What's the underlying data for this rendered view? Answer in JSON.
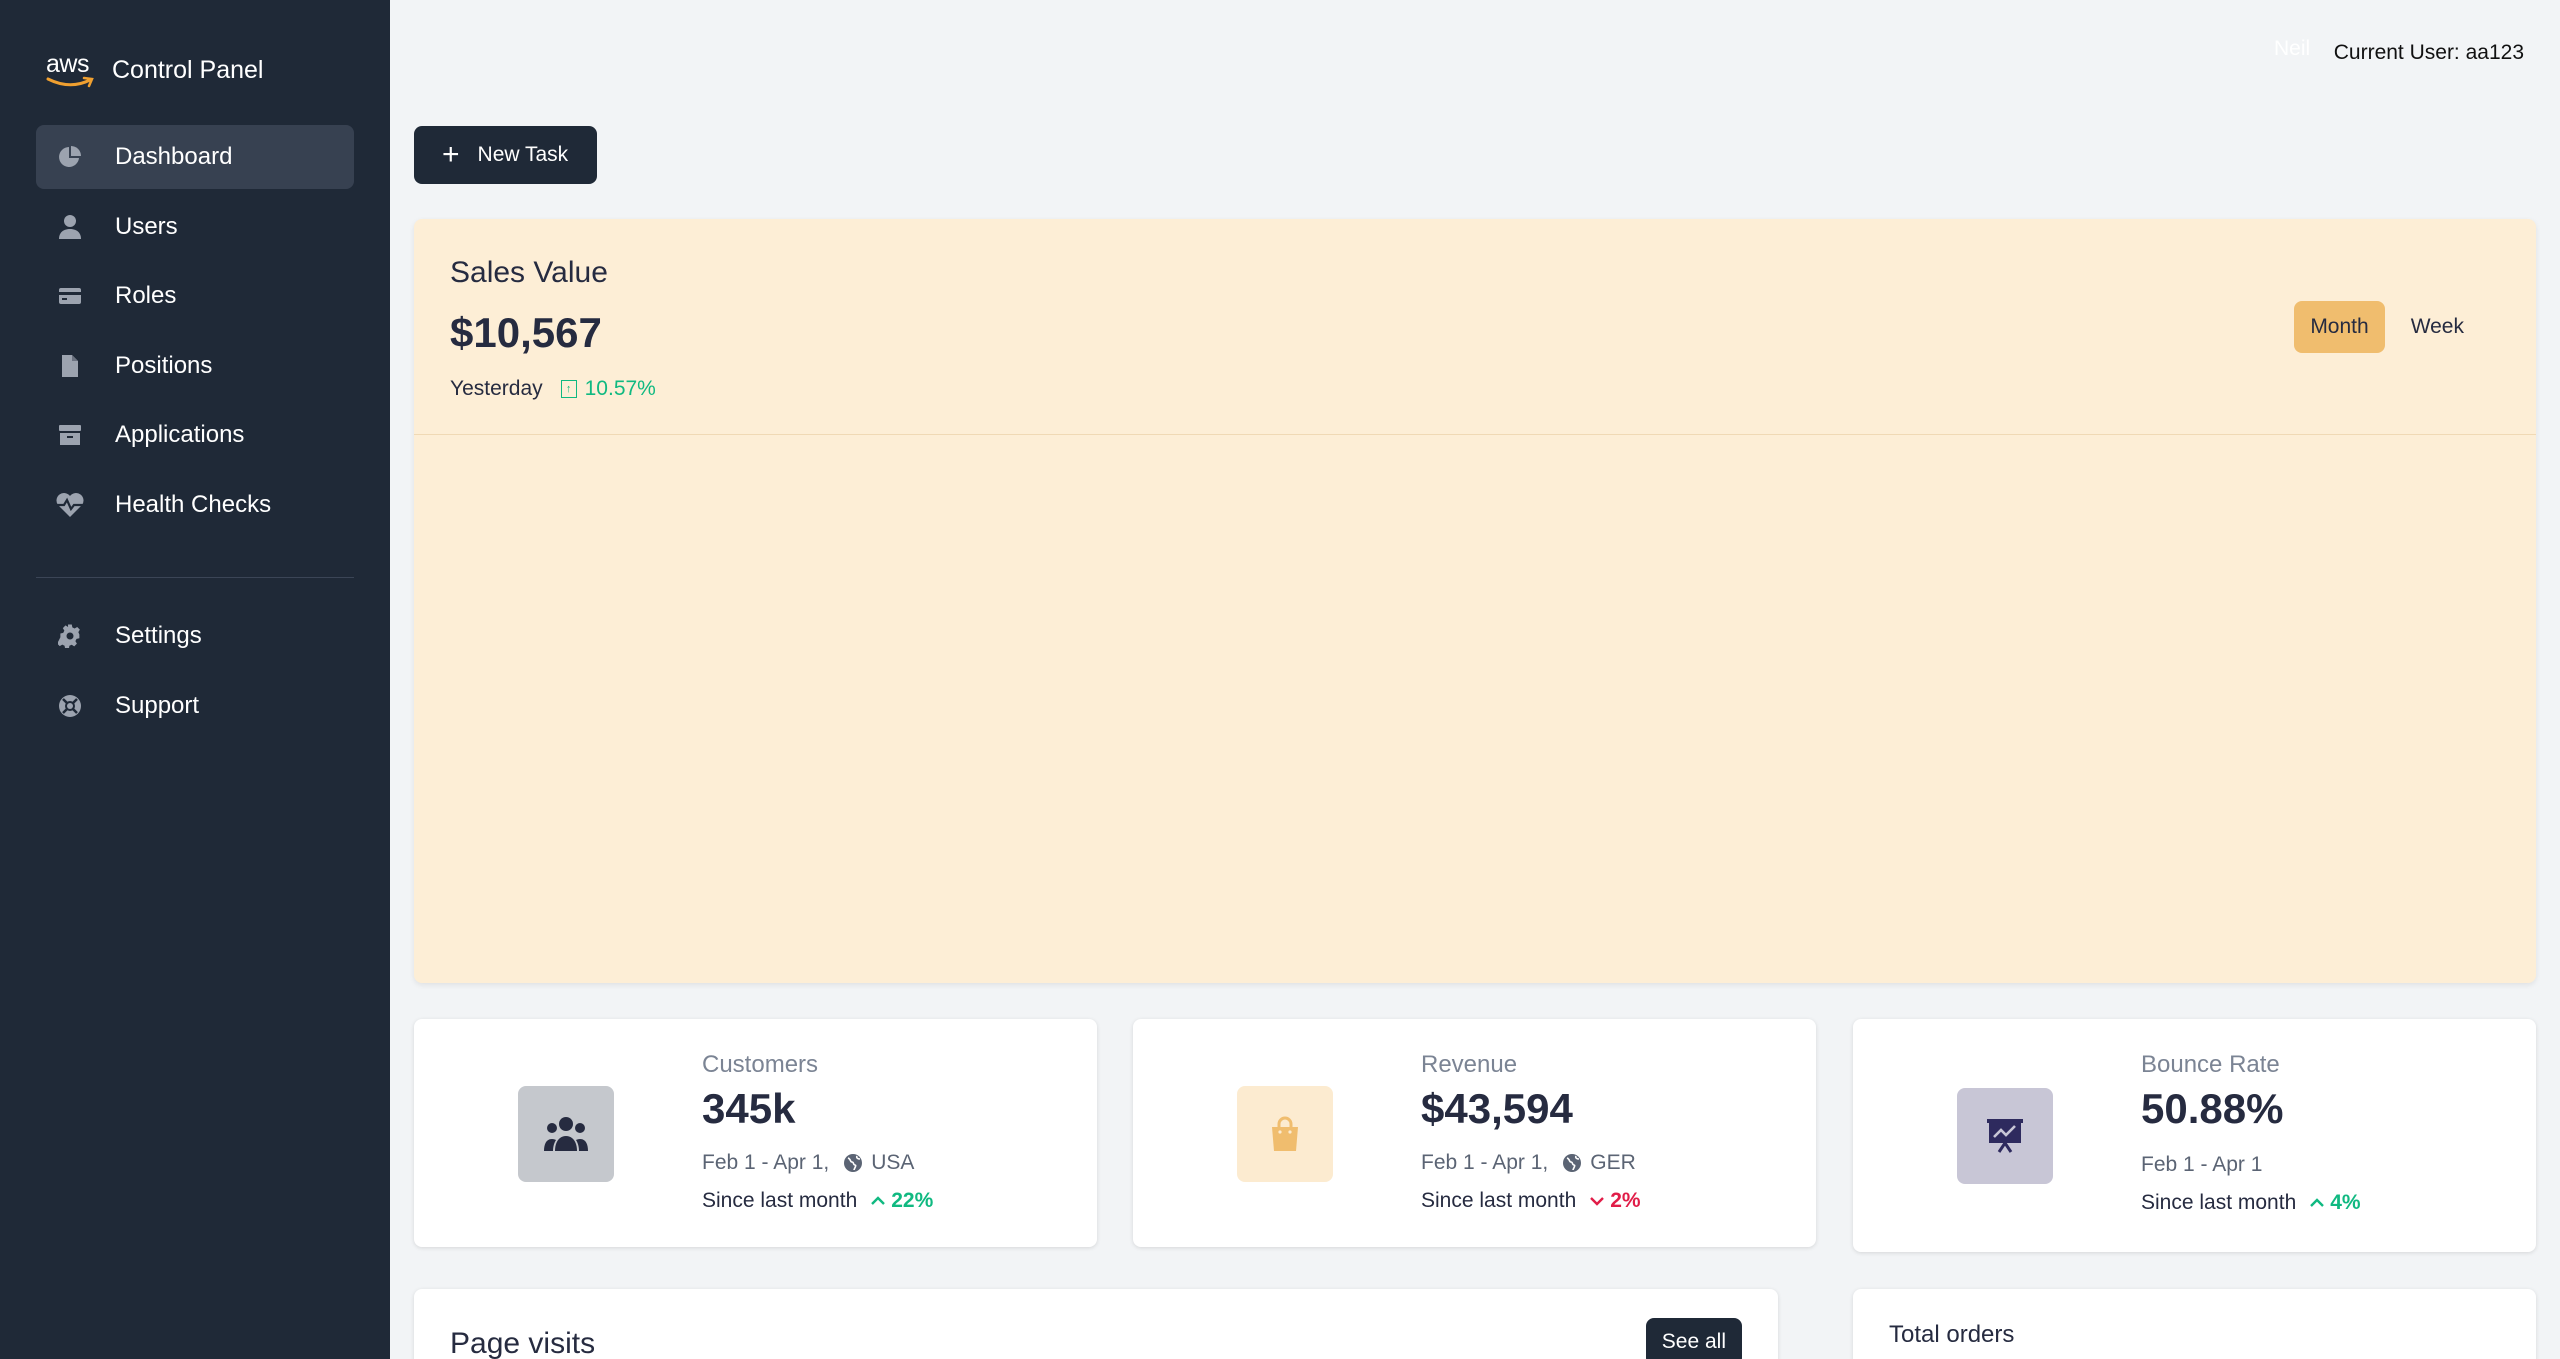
{
  "colors": {
    "sidebar_bg": "#1f2937",
    "accent": "#f0bd6e",
    "sales_card_bg": "#fdeed6",
    "positive": "#10b981",
    "negative": "#e11d48"
  },
  "brand": {
    "logo_text": "aws",
    "title": "Control Panel"
  },
  "sidebar": {
    "items": [
      {
        "label": "Dashboard",
        "icon": "chart-pie-icon",
        "active": true
      },
      {
        "label": "Users",
        "icon": "user-icon"
      },
      {
        "label": "Roles",
        "icon": "credit-card-icon"
      },
      {
        "label": "Positions",
        "icon": "document-icon"
      },
      {
        "label": "Applications",
        "icon": "archive-icon"
      },
      {
        "label": "Health Checks",
        "icon": "heartbeat-icon"
      }
    ],
    "secondary": [
      {
        "label": "Settings",
        "icon": "gear-icon"
      },
      {
        "label": "Support",
        "icon": "support-icon"
      }
    ]
  },
  "topbar": {
    "ghost_text": "Neil",
    "current_user": "Current User: aa123"
  },
  "toolbar": {
    "new_task_label": "New Task"
  },
  "sales": {
    "title": "Sales Value",
    "value": "$10,567",
    "period_label": "Yesterday",
    "change": "10.57%",
    "period_buttons": [
      "Month",
      "Week"
    ],
    "active_period": "Month"
  },
  "stats": [
    {
      "label": "Customers",
      "value": "345k",
      "range": "Feb 1 - Apr 1,",
      "region": "USA",
      "since_label": "Since last month",
      "change": "22%",
      "direction": "up",
      "icon": "users-icon",
      "icon_bg": "#c5c8cd"
    },
    {
      "label": "Revenue",
      "value": "$43,594",
      "range": "Feb 1 - Apr 1,",
      "region": "GER",
      "since_label": "Since last month",
      "change": "2%",
      "direction": "down",
      "icon": "shopping-bag-icon",
      "icon_bg": "#fcebd0"
    },
    {
      "label": "Bounce Rate",
      "value": "50.88%",
      "range": "Feb 1 - Apr 1",
      "since_label": "Since last month",
      "change": "4%",
      "direction": "up",
      "icon": "presentation-chart-icon",
      "icon_bg": "#c8c6d6"
    }
  ],
  "page_visits": {
    "title": "Page visits",
    "see_all_label": "See all"
  },
  "total_orders": {
    "title": "Total orders"
  }
}
